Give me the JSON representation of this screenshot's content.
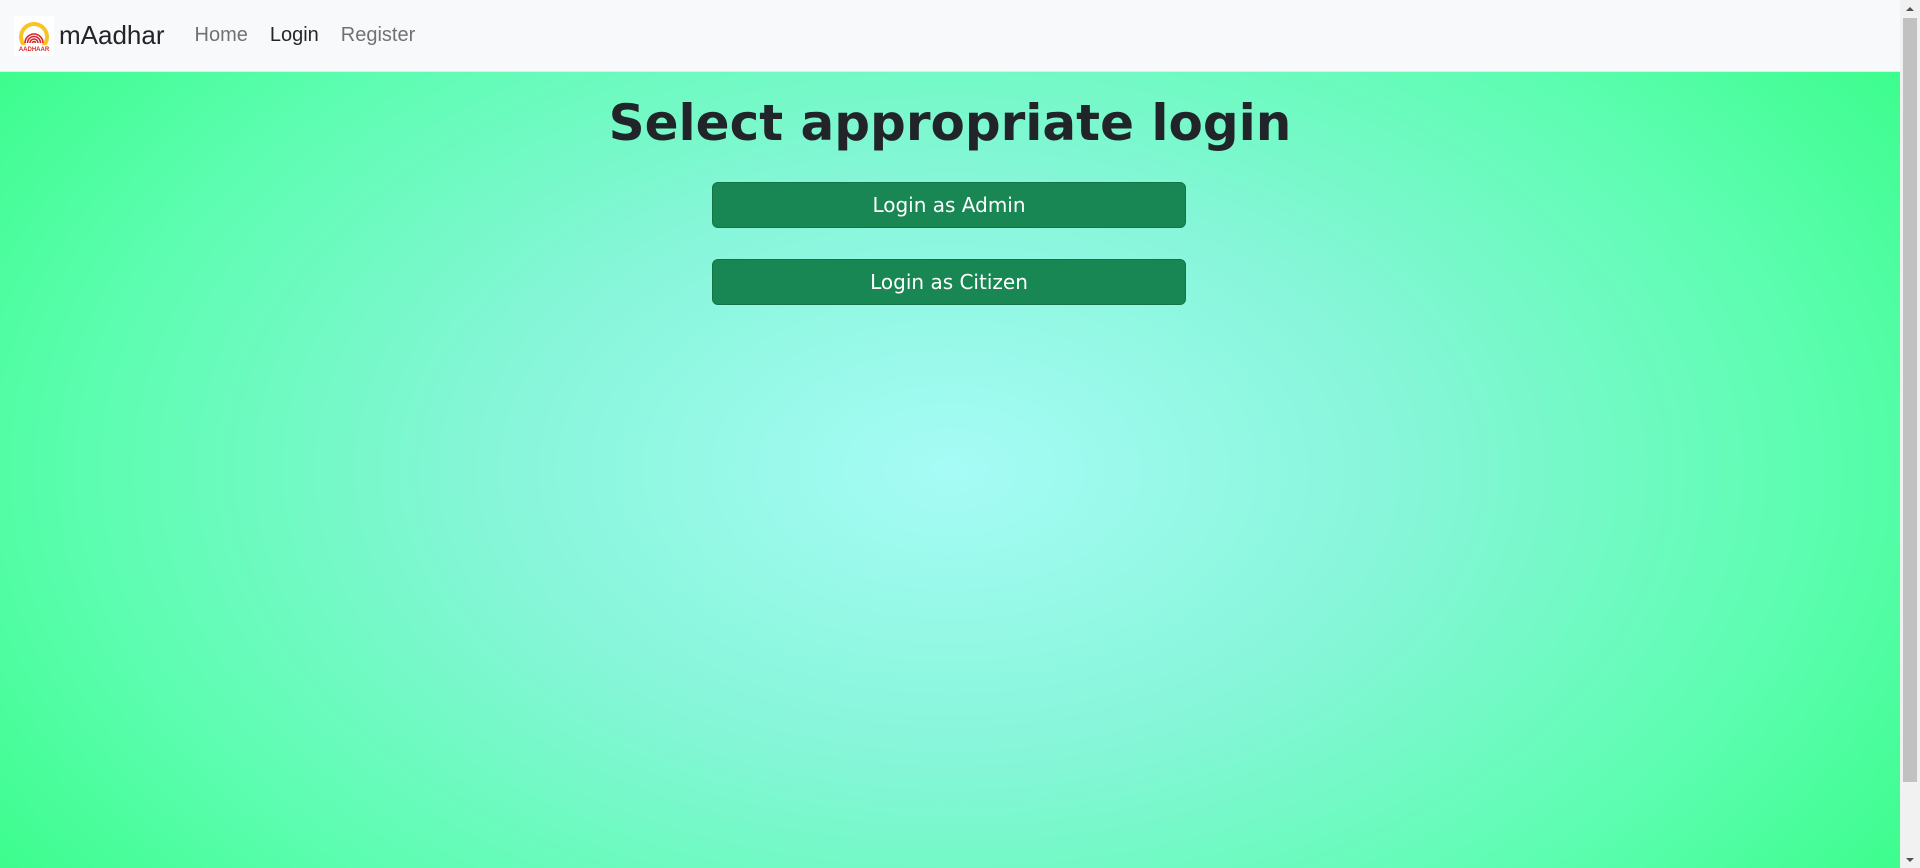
{
  "navbar": {
    "brand_text": "mAadhar",
    "logo_icon": "aadhaar-logo-icon",
    "logo_caption": "AADHAAR",
    "links": [
      {
        "label": "Home",
        "active": false
      },
      {
        "label": "Login",
        "active": true
      },
      {
        "label": "Register",
        "active": false
      }
    ]
  },
  "main": {
    "title": "Select appropriate login",
    "admin_button": "Login as Admin",
    "citizen_button": "Login as Citizen"
  },
  "colors": {
    "button_bg": "#198754",
    "navbar_bg": "#f8f9fa",
    "gradient_center": "#a6fbf6",
    "gradient_edge": "#3cfd8c"
  }
}
